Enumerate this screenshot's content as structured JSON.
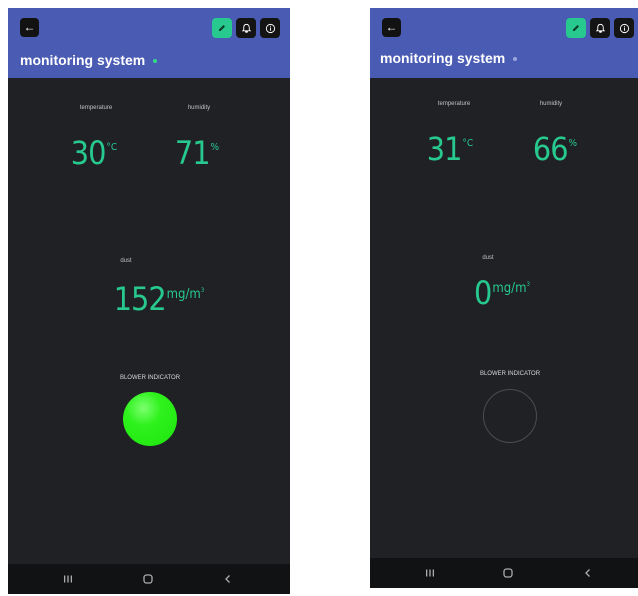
{
  "screens": [
    {
      "title": "monitoring system",
      "temperature_label": "temperature",
      "temperature_value": "30",
      "temperature_unit": "°C",
      "humidity_label": "humidity",
      "humidity_value": "71",
      "humidity_unit": "%",
      "dust_label": "dust",
      "dust_value": "152",
      "dust_unit": "mg/m",
      "dust_unit_exp": "3",
      "blower_label": "BLOWER INDICATOR",
      "blower_state": "on",
      "status_dot_color": "#39d98a"
    },
    {
      "title": "monitoring system",
      "temperature_label": "temperature",
      "temperature_value": "31",
      "temperature_unit": "°C",
      "humidity_label": "humidity",
      "humidity_value": "66",
      "humidity_unit": "%",
      "dust_label": "dust",
      "dust_value": "0",
      "dust_unit": "mg/m",
      "dust_unit_exp": "3",
      "blower_label": "BLOWER INDICATOR",
      "blower_state": "off",
      "status_dot_color": "#9aa4e0"
    }
  ],
  "icons": {
    "back": "arrow-left-icon",
    "edit": "pencil-icon",
    "notify": "bell-icon",
    "info": "info-icon",
    "nav_recents": "recents-icon",
    "nav_home": "home-icon",
    "nav_back": "chevron-back-icon"
  },
  "colors": {
    "appbar": "#4a5bb4",
    "background": "#202124",
    "value_green": "#27c98f",
    "blower_on": "#2ef21c"
  }
}
